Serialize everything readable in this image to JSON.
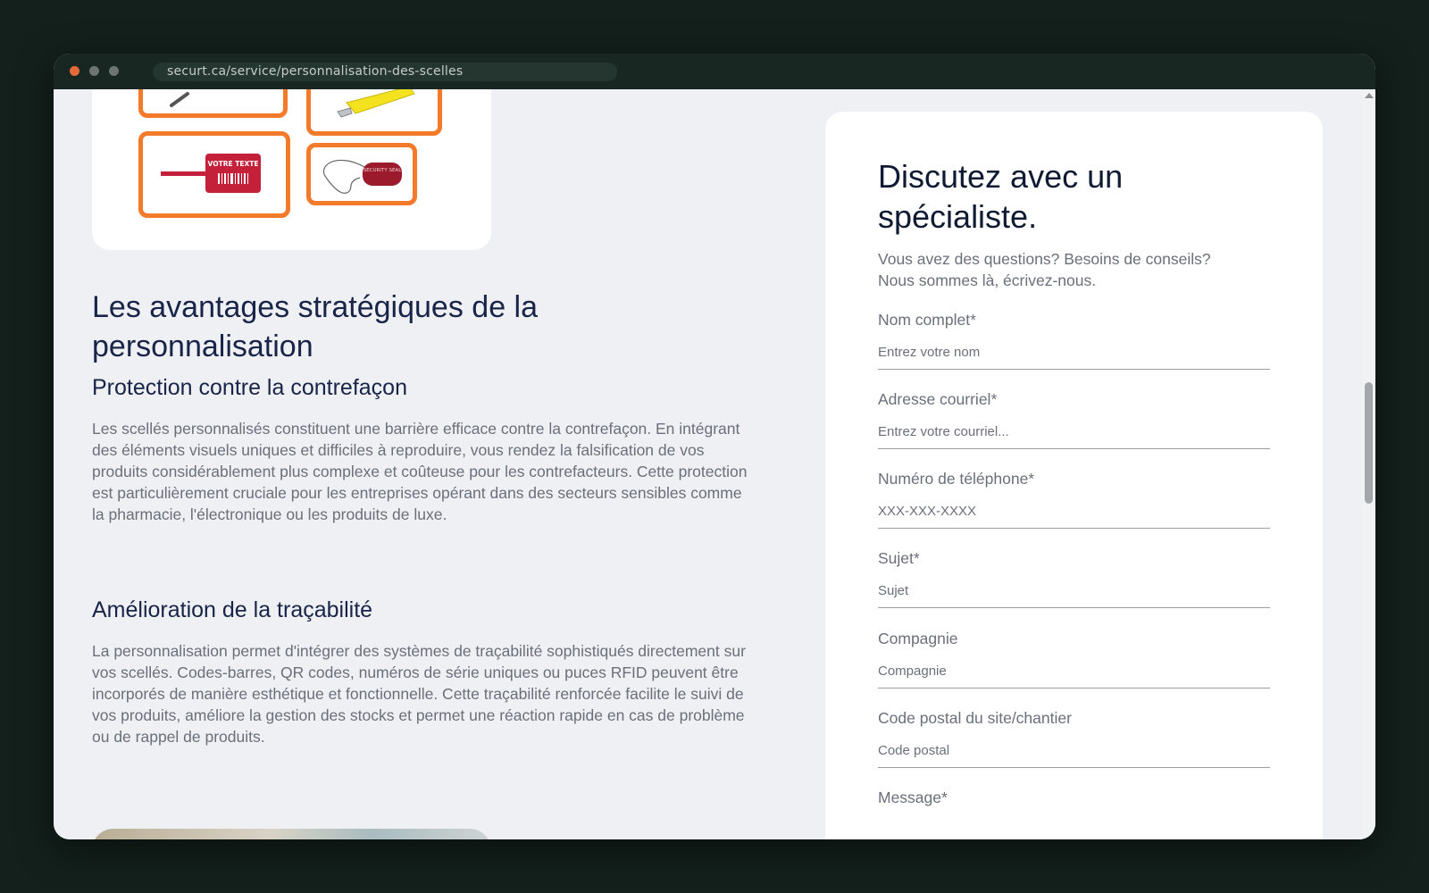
{
  "browser": {
    "url": "securt.ca/service/personnalisation-des-scelles"
  },
  "image_card": {
    "seal_text_1": "VOTRE TEXTE",
    "seal_text_2": "SECURITY SEAL"
  },
  "content": {
    "heading": "Les avantages stratégiques de la personnalisation",
    "sections": [
      {
        "title": "Protection contre la contrefaçon",
        "text": "Les scellés personnalisés constituent une barrière efficace contre la contrefaçon. En intégrant des éléments visuels uniques et difficiles à reproduire, vous rendez la falsification de vos produits considérablement plus complexe et coûteuse pour les contrefacteurs. Cette protection est particulièrement cruciale pour les entreprises opérant dans des secteurs sensibles comme la pharmacie, l'électronique ou les produits de luxe."
      },
      {
        "title": "Amélioration de la traçabilité",
        "text": "La personnalisation permet d'intégrer des systèmes de traçabilité sophistiqués directement sur vos scellés. Codes-barres, QR codes, numéros de série uniques ou puces RFID peuvent être incorporés de manière esthétique et fonctionnelle. Cette traçabilité renforcée facilite le suivi de vos produits, améliore la gestion des stocks et permet une réaction rapide en cas de problème ou de rappel de produits."
      }
    ]
  },
  "form": {
    "title": "Discutez avec un spécialiste.",
    "subtitle": "Vous avez des questions? Besoins de conseils? Nous sommes là, écrivez-nous.",
    "fields": [
      {
        "label": "Nom complet*",
        "placeholder": "Entrez votre nom",
        "value": ""
      },
      {
        "label": "Adresse courriel*",
        "placeholder": "Entrez votre courriel...",
        "value": ""
      },
      {
        "label": "Numéro de téléphone*",
        "placeholder": "XXX-XXX-XXXX",
        "value": ""
      },
      {
        "label": "Sujet*",
        "placeholder": "Sujet",
        "value": ""
      },
      {
        "label": "Compagnie",
        "placeholder": "Compagnie",
        "value": ""
      },
      {
        "label": "Code postal du site/chantier",
        "placeholder": "Code postal",
        "value": ""
      },
      {
        "label": "Message*"
      }
    ]
  },
  "colors": {
    "accent_orange": "#f27a2a",
    "heading_navy": "#182448",
    "body_text": "#6a6f7a",
    "page_bg": "#eef0f3"
  }
}
